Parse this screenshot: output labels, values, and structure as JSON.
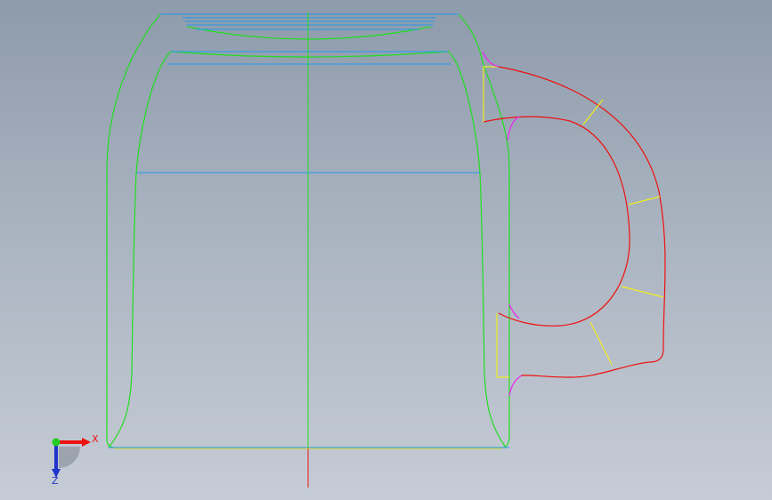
{
  "viewport": {
    "background_top": "#8e9bab",
    "background_bottom": "#c6ccd5"
  },
  "colors": {
    "body_profile": "#22dd22",
    "section_lines": "#2299ee",
    "handle_path": "#ee1111",
    "handle_sections": "#eeee22",
    "fillets": "#ee22ee",
    "axis_x": "#ee1111",
    "axis_y": "#22cc22",
    "axis_z": "#2233cc"
  },
  "triad": {
    "x_label": "X",
    "z_label": "Z",
    "x_icon": "x-axis-arrow-icon",
    "y_icon": "y-axis-origin-icon",
    "z_icon": "z-axis-arrow-icon"
  }
}
